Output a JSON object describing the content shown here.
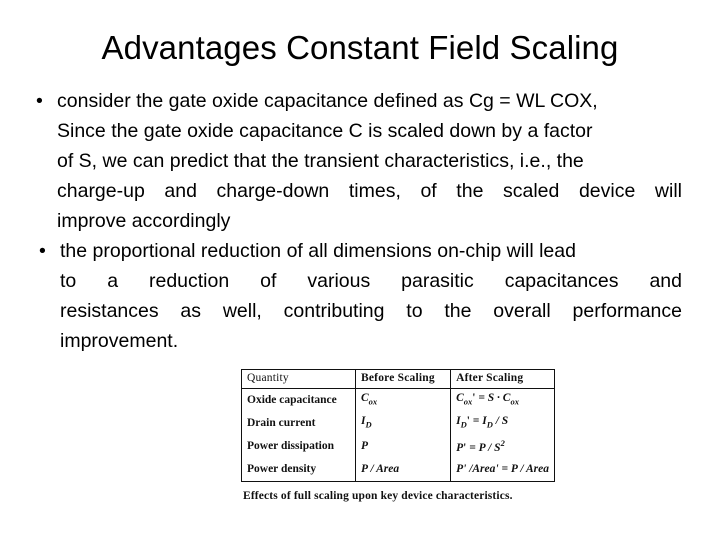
{
  "slide": {
    "title": "Advantages Constant Field Scaling"
  },
  "bullets": [
    {
      "marker": "•",
      "lines": [
        "consider the gate oxide capacitance defined as Cg = WL COX,",
        "Since the gate oxide capacitance C is scaled down by a factor",
        "of S, we can predict that the transient characteristics, i.e., the",
        "charge-up and charge-down times, of the scaled device will",
        "improve accordingly"
      ]
    },
    {
      "marker": "•",
      "lines": [
        "the proportional reduction of all dimensions on-chip will lead",
        "to a reduction of various parasitic capacitances and",
        "resistances as well, contributing to the overall performance",
        "improvement."
      ]
    }
  ],
  "figure": {
    "caption": "Effects of full scaling upon key device characteristics.",
    "table": {
      "headers": [
        "Quantity",
        "Before Scaling",
        "After Scaling"
      ],
      "rows": [
        {
          "quantity": "Oxide capacitance",
          "before_base": "C",
          "before_sub": "ox",
          "after": {
            "lhs_base": "C",
            "lhs_sub": "ox",
            "lhs_prime": "'",
            "op": "= S · C",
            "rhs_sub": "ox",
            "plain": "C_ox' = S · C_ox"
          }
        },
        {
          "quantity": "Drain current",
          "before_base": "I",
          "before_sub": "D",
          "after": {
            "lhs_base": "I",
            "lhs_sub": "D",
            "lhs_prime": "'",
            "op": "= I",
            "rhs_sub": "D",
            "tail": " / S",
            "plain": "I_D' = I_D / S"
          }
        },
        {
          "quantity": "Power dissipation",
          "before_base": "P",
          "before_sub": "",
          "after": {
            "lhs_base": "P",
            "lhs_prime": "'",
            "op": "= P / S",
            "exp": "2",
            "plain": "P' = P / S²"
          }
        },
        {
          "quantity": "Power density",
          "before_base": "P / Area",
          "before_sub": "",
          "after": {
            "plain": "P' /Area' = P / Area"
          }
        }
      ]
    }
  }
}
